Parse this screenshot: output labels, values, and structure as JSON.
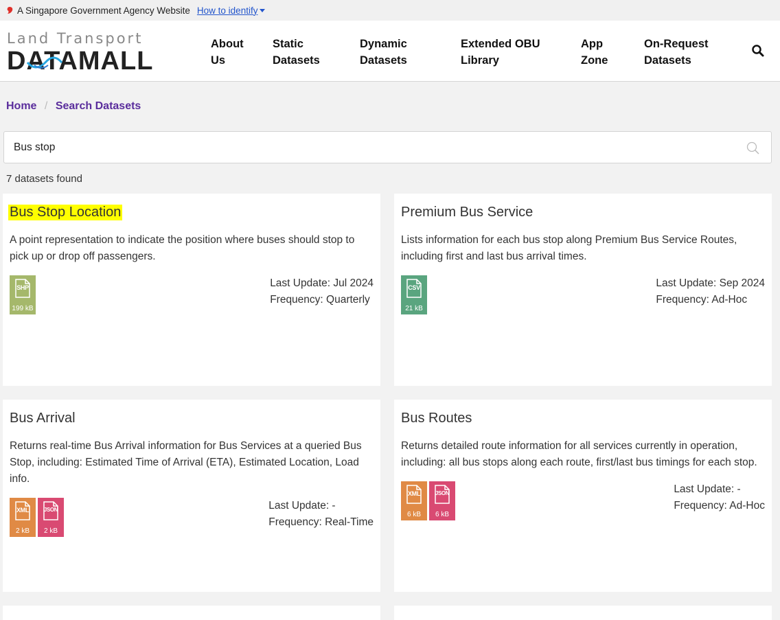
{
  "masthead": {
    "text": "A Singapore Government Agency Website",
    "identify_link": "How to identify"
  },
  "logo": {
    "top": "Land Transport",
    "bottom": "DATAMALL"
  },
  "nav": {
    "about": [
      "About",
      "Us"
    ],
    "static": [
      "Static",
      "Datasets"
    ],
    "dynamic": [
      "Dynamic",
      "Datasets"
    ],
    "obu": [
      "Extended OBU",
      "Library"
    ],
    "app": [
      "App",
      "Zone"
    ],
    "onrequest": [
      "On-Request",
      "Datasets"
    ]
  },
  "breadcrumb": {
    "home": "Home",
    "current": "Search Datasets"
  },
  "search": {
    "value": "Bus stop",
    "placeholder": ""
  },
  "results_count": "7 datasets found",
  "colors": {
    "shp": "#a5b86b",
    "csv": "#5aa57f",
    "xml": "#e08a45",
    "json": "#d94a72",
    "highlight": "#ffff00",
    "breadcrumb": "#5a2d9c"
  },
  "cards": [
    {
      "title": "Bus Stop Location",
      "description": "A point representation to indicate the position where buses should stop to pick up or drop off passengers.",
      "formats": [
        {
          "type": "SHP",
          "size": "199 kB",
          "color": "#a5b86b"
        }
      ],
      "last_update": "Last Update: Jul 2024",
      "frequency": "Frequency: Quarterly"
    },
    {
      "title": "Premium Bus Service",
      "description": "Lists information for each bus stop along Premium Bus Service Routes, including first and last bus arrival times.",
      "formats": [
        {
          "type": "CSV",
          "size": "21 kB",
          "color": "#5aa57f"
        }
      ],
      "last_update": "Last Update: Sep 2024",
      "frequency": "Frequency: Ad-Hoc"
    },
    {
      "title": "Bus Arrival",
      "description": "Returns real-time Bus Arrival information for Bus Services at a queried Bus Stop, including: Estimated Time of Arrival (ETA), Estimated Location, Load info.",
      "formats": [
        {
          "type": "XML",
          "size": "2 kB",
          "color": "#e08a45"
        },
        {
          "type": "JSON",
          "size": "2 kB",
          "color": "#d94a72"
        }
      ],
      "last_update": "Last Update: -",
      "frequency": "Frequency: Real-Time"
    },
    {
      "title": "Bus Routes",
      "description": "Returns detailed route information for all services currently in operation, including: all bus stops along each route, first/last bus timings for each stop.",
      "formats": [
        {
          "type": "XML",
          "size": "6 kB",
          "color": "#e08a45"
        },
        {
          "type": "JSON",
          "size": "6 kB",
          "color": "#d94a72"
        }
      ],
      "last_update": "Last Update: -",
      "frequency": "Frequency: Ad-Hoc"
    }
  ]
}
